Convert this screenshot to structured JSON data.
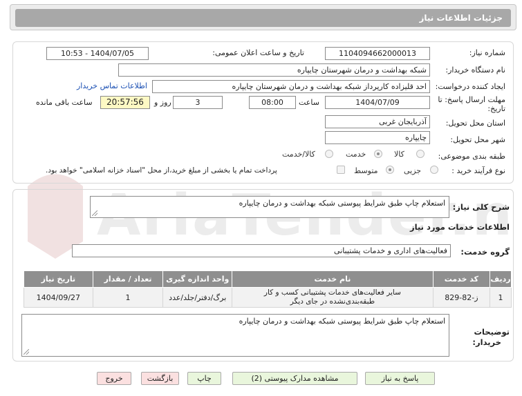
{
  "header": {
    "title": "جزئیات اطلاعات نیاز"
  },
  "form": {
    "need_number_label": "شماره نیاز:",
    "need_number": "1104094662000013",
    "announce_label": "تاریخ و ساعت اعلان عمومی:",
    "announce_value": "1404/07/05 - 10:53",
    "buyer_label": "نام دستگاه خریدار:",
    "buyer_value": "شبکه بهداشت و درمان شهرستان چایپاره",
    "creator_label": "ایجاد کننده درخواست:",
    "creator_value": "احد قلیزاده کارپرداز شبکه بهداشت و درمان شهرستان چایپاره",
    "contact_link": "اطلاعات تماس خریدار",
    "deadline_label_1": "مهلت ارسال پاسخ: تا",
    "deadline_label_2": "تاریخ:",
    "deadline_date": "1404/07/09",
    "time_label": "ساعت",
    "deadline_time": "08:00",
    "days_value": "3",
    "days_label": "روز و",
    "remaining_time": "20:57:56",
    "remaining_label": "ساعت باقی مانده",
    "province_label": "استان محل تحویل:",
    "province_value": "آذربایجان غربی",
    "city_label": "شهر محل تحویل:",
    "city_value": "چایپاره",
    "category_label": "طبقه بندی موضوعی:",
    "category_options": [
      "کالا",
      "خدمت",
      "کالا/خدمت"
    ],
    "category_selected": "خدمت",
    "process_label": "نوع فرآیند خرید :",
    "process_options": [
      "جزیی",
      "متوسط"
    ],
    "process_selected": "متوسط",
    "payment_note": "پرداخت تمام یا بخشی از مبلغ خرید،از محل \"اسناد خزانه اسلامی\" خواهد بود."
  },
  "details": {
    "summary_label": "شرح کلی نیاز:",
    "summary_value": "استعلام چاپ طبق شرایط پیوستی شبکه بهداشت و درمان چایپاره",
    "services_title": "اطلاعات خدمات مورد نیاز",
    "service_group_label": "گروه خدمت:",
    "service_group_value": "فعالیت‌های اداری و خدمات پشتیبانی",
    "table": {
      "headers": [
        "ردیف",
        "کد خدمت",
        "نام خدمت",
        "واحد اندازه گیری",
        "تعداد / مقدار",
        "تاریخ نیاز"
      ],
      "rows": [
        [
          "1",
          "ز-82-829",
          "سایر فعالیت‌های خدمات پشتیبانی کسب و کار طبقه‌بندی‌نشده در جای دیگر",
          "برگ/دفتر/جلد/عدد",
          "1",
          "1404/09/27"
        ]
      ]
    },
    "buyer_notes_label_1": "توضیحات",
    "buyer_notes_label_2": "خریدار:",
    "buyer_notes_value": "استعلام چاپ طبق شرایط پیوستی شبکه بهداشت و درمان چایپاره"
  },
  "buttons": {
    "reply": "پاسخ به نیاز",
    "attachments": "مشاهده مدارک پیوستی (2)",
    "print": "چاپ",
    "back": "بازگشت",
    "exit": "خروج"
  },
  "watermark": {
    "text": "AriaTender.neT"
  },
  "colors": {
    "header_bar": "#a8a8a8",
    "button_green": "#e9f6dc",
    "button_red": "#fbe0e0",
    "table_header": "#8f8f8f",
    "remaining_bg": "#fdf9c4"
  }
}
